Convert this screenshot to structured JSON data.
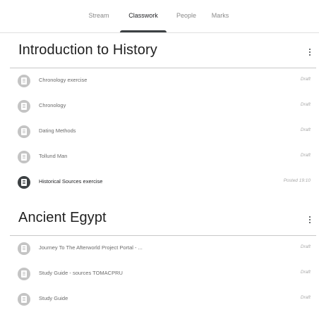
{
  "tabs": [
    {
      "label": "Stream",
      "active": false
    },
    {
      "label": "Classwork",
      "active": true
    },
    {
      "label": "People",
      "active": false
    },
    {
      "label": "Marks",
      "active": false
    }
  ],
  "sections": [
    {
      "title": "Introduction to History",
      "items": [
        {
          "title": "Chronology exercise",
          "status": "Draft",
          "icon": "assignment-icon"
        },
        {
          "title": "Chronology",
          "status": "Draft",
          "icon": "assignment-icon"
        },
        {
          "title": "Dating Methods",
          "status": "Draft",
          "icon": "assignment-icon"
        },
        {
          "title": "Tollund Man",
          "status": "Draft",
          "icon": "assignment-icon"
        },
        {
          "title": "Historical Sources exercise",
          "status": "Posted 19:10",
          "icon": "assignment-icon"
        }
      ]
    },
    {
      "title": "Ancient Egypt",
      "items": [
        {
          "title": "Journey To The Afterworld Project Portal - ...",
          "status": "Draft",
          "icon": "assignment-icon"
        },
        {
          "title": "Study Guide - sources TOMACPRU",
          "status": "Draft",
          "icon": "assignment-icon"
        },
        {
          "title": "Study Guide",
          "status": "Draft",
          "icon": "assignment-icon"
        }
      ]
    }
  ],
  "colors": {
    "draft_icon": "#c4c4c4",
    "posted_icon": "#3c4043",
    "divider": "#c8c8c8"
  }
}
